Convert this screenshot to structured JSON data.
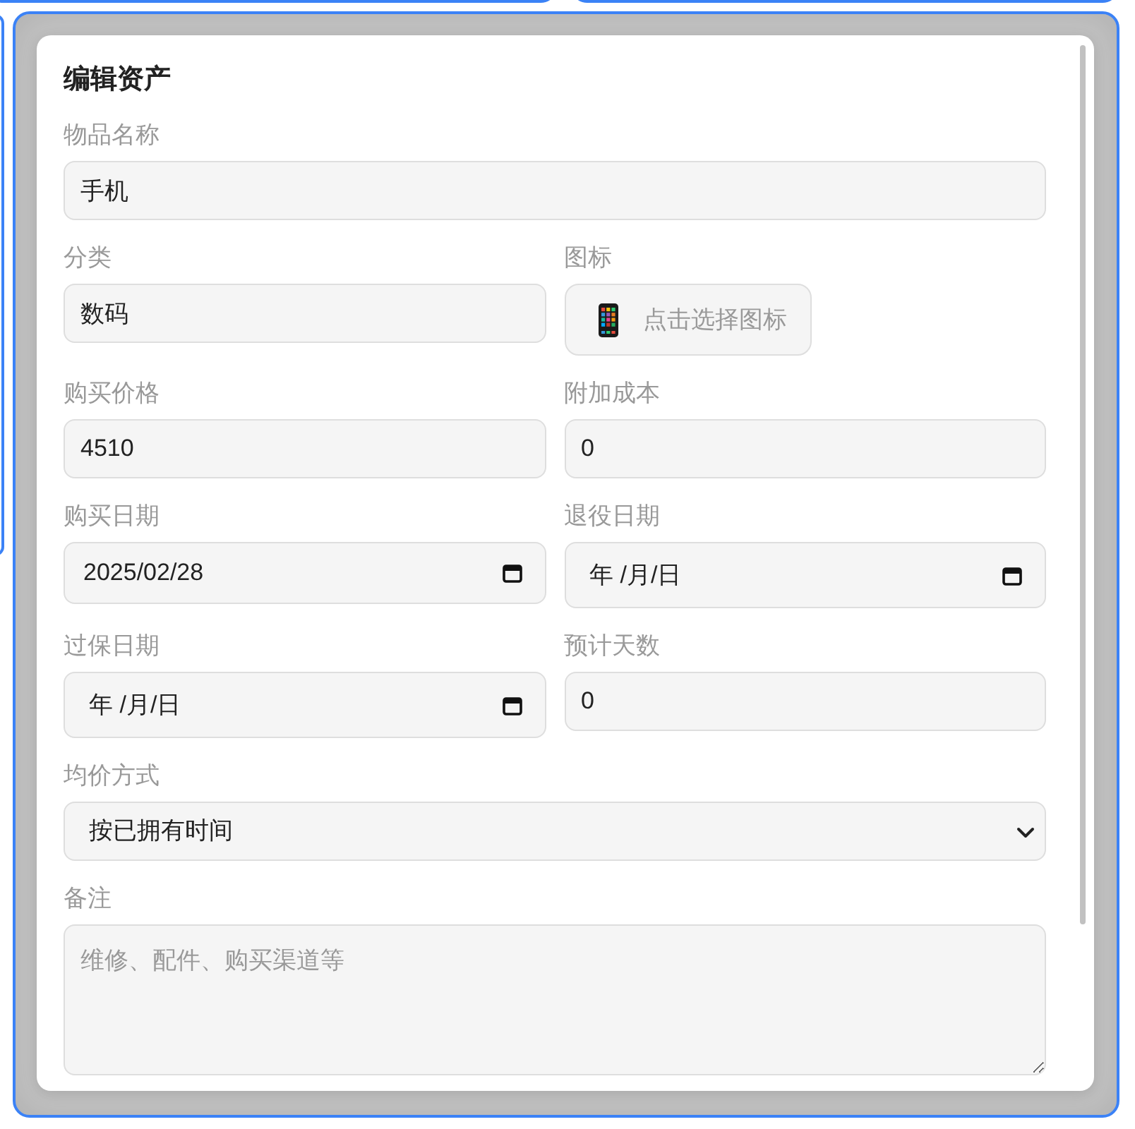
{
  "dialog": {
    "title": "编辑资产",
    "rows": [
      [
        {
          "kind": "text",
          "label": "物品名称",
          "value": "手机"
        }
      ],
      [
        {
          "kind": "text",
          "label": "分类",
          "value": "数码"
        },
        {
          "kind": "icon_picker",
          "label": "图标",
          "button_label": "点击选择图标"
        }
      ],
      [
        {
          "kind": "text",
          "label": "购买价格",
          "value": "4510"
        },
        {
          "kind": "text",
          "label": "附加成本",
          "value": "0"
        }
      ],
      [
        {
          "kind": "date",
          "label": "购买日期",
          "value": "2025/02/28"
        },
        {
          "kind": "date",
          "label": "退役日期",
          "placeholder": "年 /月/日"
        }
      ],
      [
        {
          "kind": "date",
          "label": "过保日期",
          "placeholder": "年 /月/日"
        },
        {
          "kind": "text",
          "label": "预计天数",
          "value": "0"
        }
      ],
      [
        {
          "kind": "select",
          "label": "均价方式",
          "value": "按已拥有时间"
        }
      ],
      [
        {
          "kind": "textarea",
          "label": "备注",
          "placeholder": "维修、配件、购买渠道等"
        }
      ]
    ]
  }
}
